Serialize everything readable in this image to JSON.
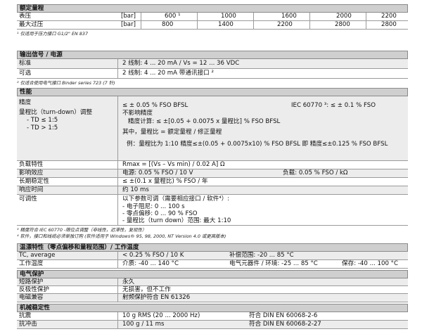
{
  "rated_range": {
    "header": "额定量程",
    "rows": [
      {
        "label": "表压",
        "unit": "[bar]",
        "values": [
          "600 ¹",
          "1000",
          "1600",
          "2000",
          "2200"
        ]
      },
      {
        "label": "最大过压",
        "unit": "[bar]",
        "values": [
          "800",
          "1400",
          "2200",
          "2800",
          "2800"
        ]
      }
    ],
    "footnote": "¹ 仅适用于压力接口 G1/2\" EN 837"
  },
  "output": {
    "header": "输出信号 / 电源",
    "standard_label": "标准",
    "standard_value": "2 线制:   4 ... 20 mA   /   Vs = 12 ... 36 VDC",
    "option_label": "可选",
    "option_value": "2 线制:   4 ... 20 mA   带通讯接口 ²",
    "footnote": "² 仅适合使用电气接口 Binder series 723 (7 针)"
  },
  "performance": {
    "header": "性能",
    "accuracy_label": "精度",
    "turndown_label": "量程比（turn-down）调整",
    "td1": "-  TD ≤ 1:5",
    "td2": "-  TD > 1:5",
    "accuracy_line1": "≤ ± 0.05 % FSO BFSL",
    "iec_line": "IEC 60770 ³: ≤ ± 0.1 % FSO",
    "td1_value": "不影响精度",
    "td2_value": "精度计算:  ≤ ±[0.05 + 0.0075 x 量程比] % FSO BFSL",
    "ratio_def": "其中，量程比 = 额定量程 / 修正量程",
    "example": "例：量程比为 1:10 精度≤±(0.05 + 0.0075x10) % FSO BFSL  即  精度≤±0.125 % FSO BFSL",
    "load_label": "负载特性",
    "load_value": "Rmax = [(Vs – Vs min) / 0.02 A] Ω",
    "influence_label": "影响效应",
    "influence_supply": "电源:         0.05 % FSO / 10 V",
    "influence_load": "负载:          0.05 % FSO / kΩ",
    "stability_label": "长期稳定性",
    "stability_value": "≤ ±(0.1 x 量程比) % FSO / 年",
    "response_label": "响应时间",
    "response_value": "约 10 ms",
    "adjust_label": "可调性",
    "adjust_intro": "以下参数可调（需要相应接口 / 软件⁴）:",
    "adjust_1": "- 电子阻尼:   0 ... 100 s",
    "adjust_2": "- 零点偏移:   0 ... 90 % FSO",
    "adjust_3": "- 量程比（turn down）范围:     最大 1:10",
    "footnote3": "³ 精度符合 IEC 60770 -限位点调整（非线性，迟滞性，复现性）",
    "footnote4": "⁴ 软件，接口和线缆必须单独订购 (软件适用于 Windows® 95, 98, 2000, NT Version 4.0 或更高版本)"
  },
  "thermal": {
    "header": "温漂特性（零点偏移和量程范围）/ 工作温度",
    "tc_label": "TC, average",
    "tc_value": "< 0.25 % FSO / 10 K",
    "comp_label": "补偿范围: -20 ... 85 °C",
    "temp_label": "工作温度",
    "medium": "介质: -40 ... 140 °C",
    "electronics": "电气元器件 / 环境: -25 ... 85 °C",
    "storage": "保存:    -40 ... 100 °C"
  },
  "protection": {
    "header": "电气保护",
    "short_label": "短路保护",
    "short_value": "永久",
    "reverse_label": "反极性保护",
    "reverse_value": "无损害，但不工作",
    "emc_label": "电磁兼容",
    "emc_value": "射频保护符合 EN 61326"
  },
  "mechanical": {
    "header": "机械稳定性",
    "vib_label": "抗震",
    "vib_value": "10 g RMS (20 ... 2000 Hz)",
    "vib_std": "符合 DIN EN 60068-2-6",
    "shock_label": "抗冲击",
    "shock_value": "100 g / 11 ms",
    "shock_std": "符合 DIN EN 60068-2-27"
  }
}
